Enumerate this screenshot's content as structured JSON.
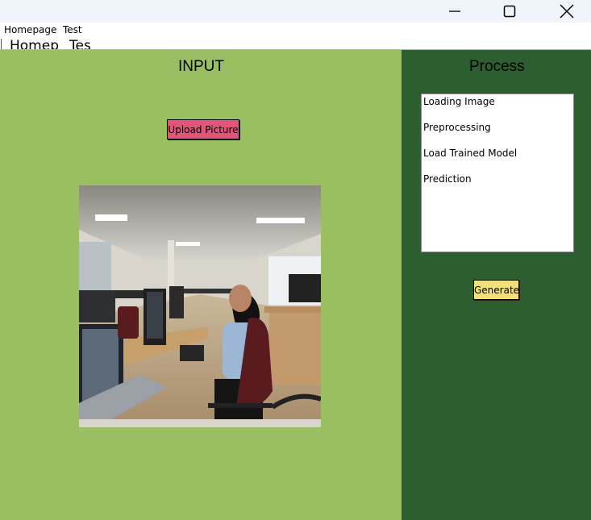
{
  "menu": {
    "homepage": "Homepage",
    "test": "Test"
  },
  "tabs": {
    "homepage": "Homep",
    "test": "Tes"
  },
  "input_panel": {
    "title": "INPUT",
    "upload_label": "Upload Picture",
    "bg_color": "#9abf62",
    "button_color": "#e25479"
  },
  "process_panel": {
    "title": "Process",
    "steps": [
      "Loading Image",
      "Preprocessing",
      "Load Trained Model",
      "Prediction"
    ],
    "generate_label": "Generate",
    "bg_color": "#2d5e2f",
    "button_color": "#f2e07a"
  },
  "window_controls": [
    "minimize-icon",
    "maximize-icon",
    "close-icon"
  ]
}
